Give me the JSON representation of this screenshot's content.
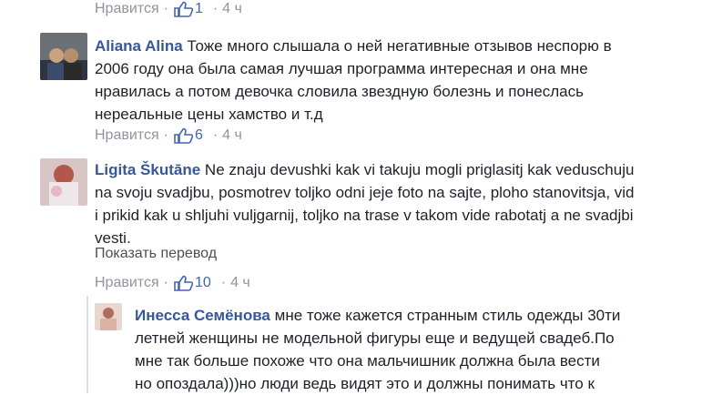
{
  "top_meta": {
    "like": "Нравится",
    "count": "1",
    "time": "4 ч"
  },
  "comments": [
    {
      "author": "Aliana Alina",
      "lines": [
        "Тоже много слышала о ней негативные отзывов неспорю в",
        "2006 году она была самая лучшая программа интересная и она мне",
        "нравилась а потом девочка словила звездную болезнь и понеслась",
        "нереальные цены хамство и т.д"
      ],
      "meta": {
        "like": "Нравится",
        "count": "6",
        "time": "4 ч"
      }
    },
    {
      "author": "Ligita Škutāne",
      "lines": [
        "Ne znaju devushki kak vi takuju mogli priglasitj kak veduschuju",
        "na svoju svadjbu, posmotrev toljko odni jeje foto na sajte, ploho stanovitsja, vid",
        "i prikid kak u shljuhi vuljgarnij, toljko na trase v takom vide rabotatj a ne svadjbi",
        "vesti."
      ],
      "translate": "Показать перевод",
      "meta": {
        "like": "Нравится",
        "count": "10",
        "time": "4 ч"
      }
    }
  ],
  "reply": {
    "author": "Инесса Семёнова",
    "lines": [
      "мне тоже кажется странным стиль одежды 30ти",
      "летней женщины не модельной фигуры еще и ведущей свадеб.По",
      "мне так больше похоже что она мальчишник должна была вести",
      "но опоздала)))но люди ведь видят это и должны понимать что к"
    ]
  },
  "colors": {
    "link": "#365899",
    "meta": "#90949c",
    "count": "#4267b2",
    "text": "#1d2129"
  },
  "icons": [
    "thumbs-up-icon"
  ]
}
